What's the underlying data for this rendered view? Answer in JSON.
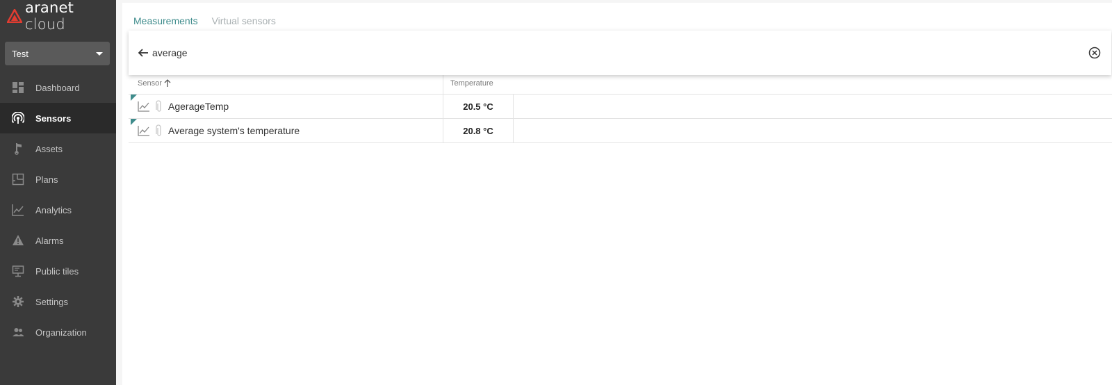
{
  "app": {
    "logo_main": "aranet",
    "logo_sub": "cloud",
    "brand_color": "#e03c31",
    "accent_color": "#3f8c8c"
  },
  "sidebar": {
    "org_select": "Test",
    "items": [
      {
        "label": "Dashboard",
        "icon": "dashboard-icon",
        "active": false
      },
      {
        "label": "Sensors",
        "icon": "sensors-icon",
        "active": true
      },
      {
        "label": "Assets",
        "icon": "assets-icon",
        "active": false
      },
      {
        "label": "Plans",
        "icon": "plans-icon",
        "active": false
      },
      {
        "label": "Analytics",
        "icon": "analytics-icon",
        "active": false
      },
      {
        "label": "Alarms",
        "icon": "alarm-icon",
        "active": false
      },
      {
        "label": "Public tiles",
        "icon": "public-tiles-icon",
        "active": false
      },
      {
        "label": "Settings",
        "icon": "gear-icon",
        "active": false
      },
      {
        "label": "Organization",
        "icon": "people-icon",
        "active": false
      }
    ]
  },
  "tabs": [
    {
      "label": "Measurements",
      "active": true
    },
    {
      "label": "Virtual sensors",
      "active": false
    }
  ],
  "search": {
    "value": "average"
  },
  "table": {
    "columns": {
      "sensor": "Sensor",
      "temperature": "Temperature"
    },
    "rows": [
      {
        "name": "AgerageTemp",
        "temperature": "20.5 °C"
      },
      {
        "name": "Average system's temperature",
        "temperature": "20.8 °C"
      }
    ]
  }
}
